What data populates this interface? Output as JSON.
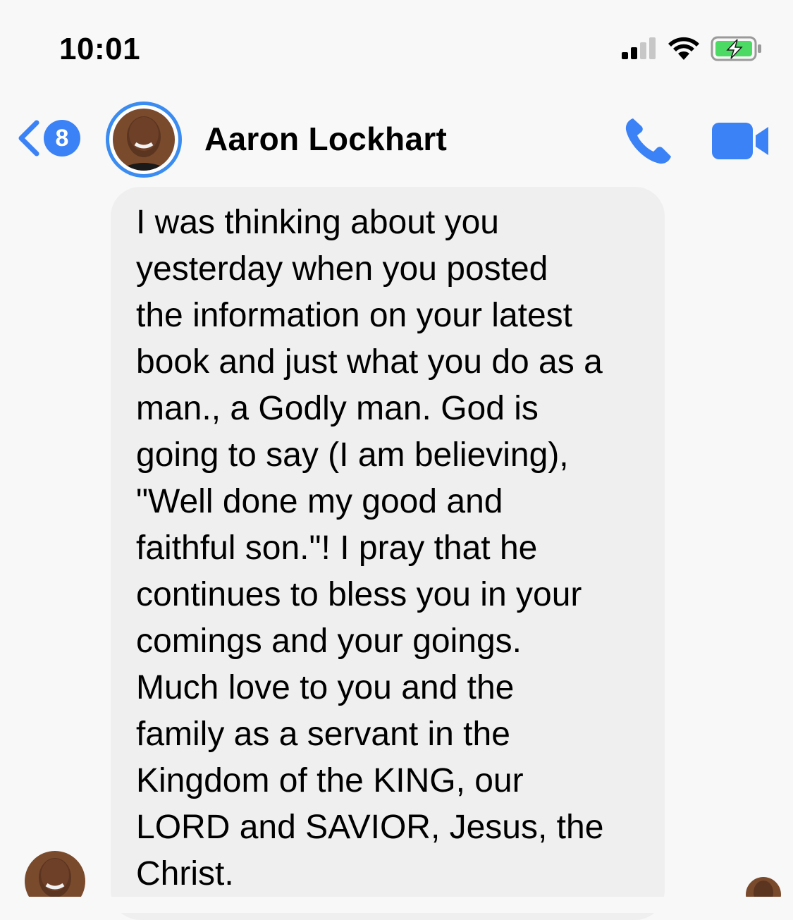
{
  "status_bar": {
    "time": "10:01",
    "icons": [
      "signal-icon",
      "wifi-icon",
      "battery-charging-icon"
    ]
  },
  "header": {
    "back_badge_count": "8",
    "contact_name": "Aaron Lockhart",
    "icons": [
      "back-chevron-icon",
      "phone-icon",
      "video-camera-icon"
    ]
  },
  "message": {
    "text": "I was thinking about you\nyesterday when you posted\nthe information on your latest\nbook and just what you do as a\nman., a Godly man.  God is\ngoing to say (I am believing),\n\"Well done my good and\nfaithful son.\"!  I pray that he\ncontinues to bless you in your\ncomings and your goings.\nMuch love to you and the\nfamily as a servant in the\nKingdom of the KING, our\nLORD and SAVIOR, Jesus, the\nChrist."
  },
  "colors": {
    "accent": "#3b82f6",
    "bubble": "#efefef",
    "background": "#f8f8f8",
    "battery_fill": "#4cd964"
  }
}
